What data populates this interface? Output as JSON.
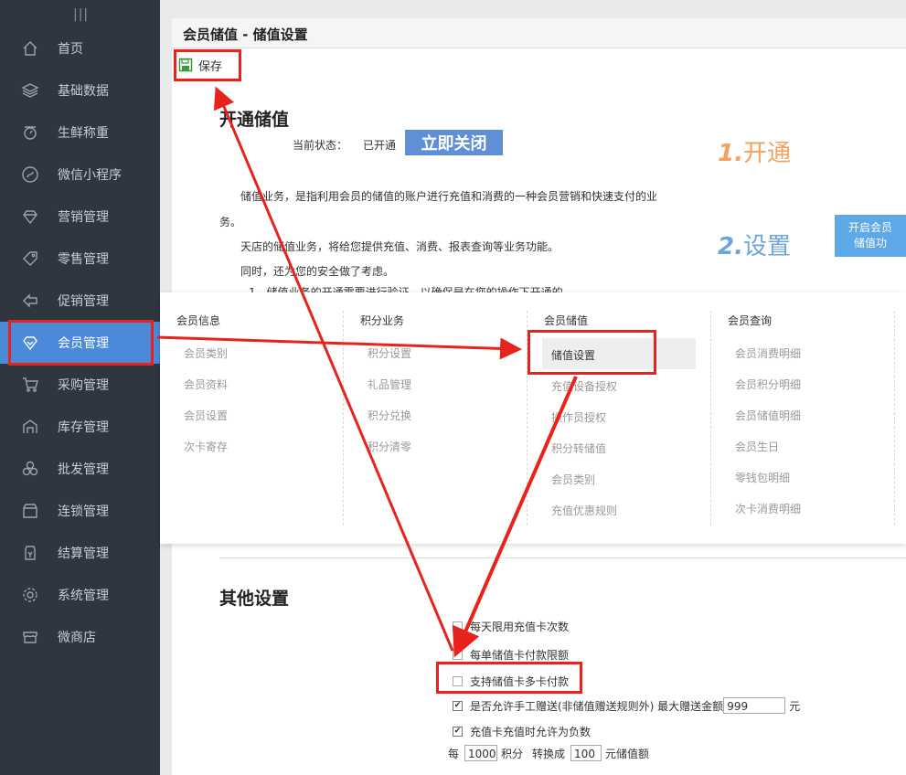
{
  "sidebar": {
    "handle": "|||",
    "items": [
      {
        "label": "首页",
        "icon": "home-icon"
      },
      {
        "label": "基础数据",
        "icon": "layers-icon"
      },
      {
        "label": "生鲜称重",
        "icon": "scale-icon"
      },
      {
        "label": "微信小程序",
        "icon": "miniprogram-icon"
      },
      {
        "label": "营销管理",
        "icon": "diamond-icon"
      },
      {
        "label": "零售管理",
        "icon": "tag-icon"
      },
      {
        "label": "促销管理",
        "icon": "promo-icon"
      },
      {
        "label": "会员管理",
        "icon": "member-diamond-icon",
        "active": true
      },
      {
        "label": "采购管理",
        "icon": "cart-icon"
      },
      {
        "label": "库存管理",
        "icon": "warehouse-icon"
      },
      {
        "label": "批发管理",
        "icon": "boxes-icon"
      },
      {
        "label": "连锁管理",
        "icon": "store-icon"
      },
      {
        "label": "结算管理",
        "icon": "settlement-icon"
      },
      {
        "label": "系统管理",
        "icon": "gear-icon"
      },
      {
        "label": "微商店",
        "icon": "shop-icon"
      }
    ]
  },
  "header": {
    "title": "会员储值 - 储值设置"
  },
  "toolbar": {
    "save_label": "保存",
    "save_icon": "save-icon"
  },
  "open_section": {
    "title": "开通储值",
    "status_label": "当前状态：",
    "status_value": "已开通",
    "close_button": "立即关闭",
    "step1_num": "1.",
    "step1_text": "开通",
    "step2_num": "2.",
    "step2_text": "设置",
    "open_button_line1": "开启会员",
    "open_button_line2": "储值功",
    "para1a": "储值业务，是指利用会员的储值的账户进行充值和消费的一种会员营销和快速支付的业",
    "para1b": "务。",
    "para2": "天店的储值业务，将给您提供充值、消费、报表查询等业务功能。",
    "para3": "同时，还为您的安全做了考虑。",
    "para4": "1、储值业务的开通需要进行验证，以确保是在您的操作下开通的"
  },
  "menu": {
    "columns": [
      {
        "header": "会员信息",
        "items": [
          "会员类别",
          "会员资料",
          "会员设置",
          "次卡寄存"
        ]
      },
      {
        "header": "积分业务",
        "items": [
          "积分设置",
          "礼品管理",
          "积分兑换",
          "积分清零"
        ]
      },
      {
        "header": "会员储值",
        "items": [
          "储值设置",
          "充值设备授权",
          "操作员授权",
          "积分转储值",
          "会员类别",
          "充值优惠规则"
        ]
      },
      {
        "header": "会员查询",
        "items": [
          "会员消费明细",
          "会员积分明细",
          "会员储值明细",
          "会员生日",
          "零钱包明细",
          "次卡消费明细"
        ]
      }
    ]
  },
  "other_section": {
    "title": "其他设置",
    "options": [
      {
        "label": "每天限用充值卡次数",
        "checked": false
      },
      {
        "label": "每单储值卡付款限额",
        "checked": false
      },
      {
        "label": "支持储值卡多卡付款",
        "checked": false
      },
      {
        "label": "是否允许手工赠送(非储值赠送规则外) 最大赠送金额",
        "checked": true,
        "input_value": "999",
        "suffix": "元"
      },
      {
        "label": "充值卡充值时允许为负数",
        "checked": true
      }
    ],
    "points": {
      "prefix": "每",
      "points_value": "1000",
      "mid1": "积分",
      "mid2": "转换成",
      "money_value": "100",
      "suffix": "元储值额"
    }
  },
  "colors": {
    "sidebar_bg": "#2f3640",
    "active": "#4a8ad9",
    "highlight": "#e8231c",
    "step1": "#f3a25f",
    "step2": "#6fa3dd"
  }
}
